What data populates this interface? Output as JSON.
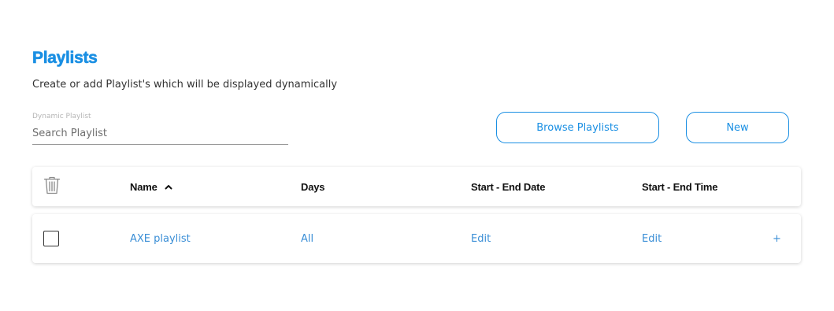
{
  "page": {
    "title": "Playlists",
    "subtitle": "Create or add Playlist's which will be displayed dynamically"
  },
  "search": {
    "label": "Dynamic Playlist",
    "placeholder": "Search Playlist",
    "value": ""
  },
  "buttons": {
    "browse": "Browse Playlists",
    "new": "New"
  },
  "table": {
    "columns": {
      "name": "Name",
      "days": "Days",
      "dates": "Start - End Date",
      "times": "Start - End Time"
    },
    "sort": {
      "column": "name",
      "direction": "ascending"
    },
    "rows": [
      {
        "name": "AXE playlist",
        "days": "All",
        "dates": "Edit",
        "times": "Edit",
        "add": "+",
        "checked": false
      }
    ]
  },
  "icons": {
    "delete": "trash-icon",
    "sort": "chevron-up-icon"
  },
  "colors": {
    "accent": "#1a8fe3",
    "link": "#3a8ed6"
  }
}
